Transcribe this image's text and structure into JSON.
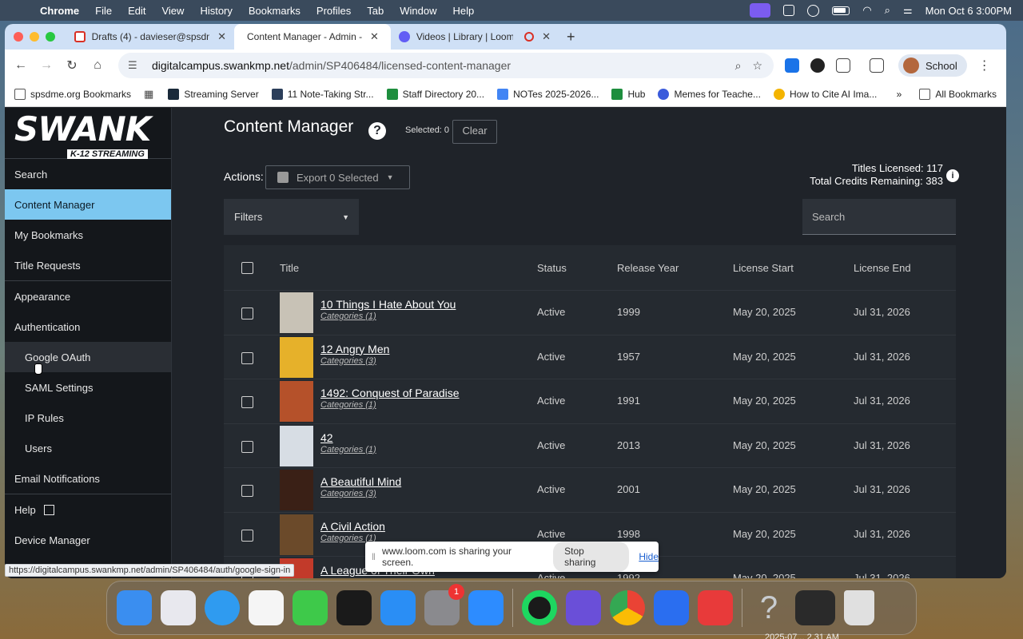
{
  "menubar": {
    "app": "Chrome",
    "items": [
      "File",
      "Edit",
      "View",
      "History",
      "Bookmarks",
      "Profiles",
      "Tab",
      "Window",
      "Help"
    ],
    "clock": "Mon Oct 6  3:00PM"
  },
  "tabs": [
    {
      "title": "Drafts (4) - davieser@spsdm",
      "icon": "gmail-icon",
      "color": "#d93025"
    },
    {
      "title": "Content Manager - Admin - S",
      "icon": "swank-icon",
      "color": "#ffffff"
    },
    {
      "title": "Videos | Library | Loom",
      "icon": "loom-icon",
      "color": "#625df5"
    }
  ],
  "toolbar": {
    "url_host": "digitalcampus.swankmp.net",
    "url_path": "/admin/SP406484/licensed-content-manager",
    "profile": "School"
  },
  "bookmarks": [
    {
      "label": "spsdme.org Bookmarks",
      "color": "#666666"
    },
    {
      "label": "Streaming Server",
      "color": "#1a2a3a"
    },
    {
      "label": "11 Note-Taking Str...",
      "color": "#2b3e5a"
    },
    {
      "label": "Staff Directory 20...",
      "color": "#1e8e3e"
    },
    {
      "label": "NOTes 2025-2026...",
      "color": "#4285f4"
    },
    {
      "label": "Hub",
      "color": "#1e8e3e"
    },
    {
      "label": "Memes for Teache...",
      "color": "#3b5bdb"
    },
    {
      "label": "How to Cite AI Ima...",
      "color": "#f4b400"
    }
  ],
  "bookmarks_all": "All Bookmarks",
  "sidebar": {
    "logo_main": "SWANK",
    "logo_sub": "K-12 STREAMING",
    "items": [
      {
        "label": "Search"
      },
      {
        "label": "Content Manager"
      },
      {
        "label": "My Bookmarks"
      },
      {
        "label": "Title Requests"
      },
      {
        "label": "Appearance"
      },
      {
        "label": "Authentication"
      },
      {
        "label": "Google OAuth"
      },
      {
        "label": "SAML Settings"
      },
      {
        "label": "IP Rules"
      },
      {
        "label": "Users"
      },
      {
        "label": "Email Notifications"
      },
      {
        "label": "Help"
      },
      {
        "label": "Device Manager"
      }
    ]
  },
  "main": {
    "title": "Content Manager",
    "selected": "Selected: 0",
    "clear": "Clear",
    "actions_label": "Actions:",
    "export_label": "Export 0 Selected",
    "titles_licensed": "Titles Licensed: 117",
    "credits_remaining": "Total Credits Remaining: 383",
    "filters": "Filters",
    "search_placeholder": "Search"
  },
  "table": {
    "headers": {
      "title": "Title",
      "status": "Status",
      "year": "Release Year",
      "start": "License Start",
      "end": "License End"
    },
    "rows": [
      {
        "title": "10 Things I Hate About You",
        "cat": "Categories (1)",
        "status": "Active",
        "year": "1999",
        "start": "May 20, 2025",
        "end": "Jul 31, 2026",
        "poster": "#c8c2b6"
      },
      {
        "title": "12 Angry Men",
        "cat": "Categories (3)",
        "status": "Active",
        "year": "1957",
        "start": "May 20, 2025",
        "end": "Jul 31, 2026",
        "poster": "#e6b12a"
      },
      {
        "title": "1492: Conquest of Paradise",
        "cat": "Categories (1)",
        "status": "Active",
        "year": "1991",
        "start": "May 20, 2025",
        "end": "Jul 31, 2026",
        "poster": "#b5512a"
      },
      {
        "title": "42",
        "cat": "Categories (1)",
        "status": "Active",
        "year": "2013",
        "start": "May 20, 2025",
        "end": "Jul 31, 2026",
        "poster": "#d7dde4"
      },
      {
        "title": "A Beautiful Mind",
        "cat": "Categories (3)",
        "status": "Active",
        "year": "2001",
        "start": "May 20, 2025",
        "end": "Jul 31, 2026",
        "poster": "#3a2016"
      },
      {
        "title": "A Civil Action",
        "cat": "Categories (1)",
        "status": "Active",
        "year": "1998",
        "start": "May 20, 2025",
        "end": "Jul 31, 2026",
        "poster": "#6b4a2a"
      },
      {
        "title": "A League of Their Own",
        "cat": "",
        "status": "Active",
        "year": "1992",
        "start": "May 20, 2025",
        "end": "Jul 31, 2026",
        "poster": "#c23a2a"
      }
    ]
  },
  "status_url": "https://digitalcampus.swankmp.net/admin/SP406484/auth/google-sign-in",
  "loom": {
    "message": "www.loom.com is sharing your screen.",
    "stop": "Stop sharing",
    "hide": "Hide"
  },
  "dock": {
    "badge": "1",
    "apps": [
      {
        "name": "finder-icon",
        "color": "#3a8ef0"
      },
      {
        "name": "launchpad-icon",
        "color": "#e8e8ee"
      },
      {
        "name": "safari-icon",
        "color": "#2f9bf0"
      },
      {
        "name": "photos-icon",
        "color": "#f5f5f5"
      },
      {
        "name": "facetime-icon",
        "color": "#3ec94a"
      },
      {
        "name": "appletv-icon",
        "color": "#1a1a1a"
      },
      {
        "name": "appstore-icon",
        "color": "#2a8ef5"
      },
      {
        "name": "settings-icon",
        "color": "#8a8a8e"
      },
      {
        "name": "zoom-icon",
        "color": "#2d8cff"
      },
      {
        "name": "spotify-icon",
        "color": "#1a1a1a"
      },
      {
        "name": "purple-app-icon",
        "color": "#6a4fd8"
      },
      {
        "name": "chrome-icon",
        "color": "#ffffff"
      },
      {
        "name": "q-app-icon",
        "color": "#2a6ef0"
      },
      {
        "name": "office-icon",
        "color": "#e83a3a"
      }
    ],
    "extras": [
      {
        "name": "help-icon",
        "color": "#9aa0a6"
      },
      {
        "name": "recent-window-icon",
        "color": "#2a2a2a"
      },
      {
        "name": "trash-icon",
        "color": "#e0e0e0"
      }
    ],
    "time_label": "2025-07... 2.31 AM"
  }
}
